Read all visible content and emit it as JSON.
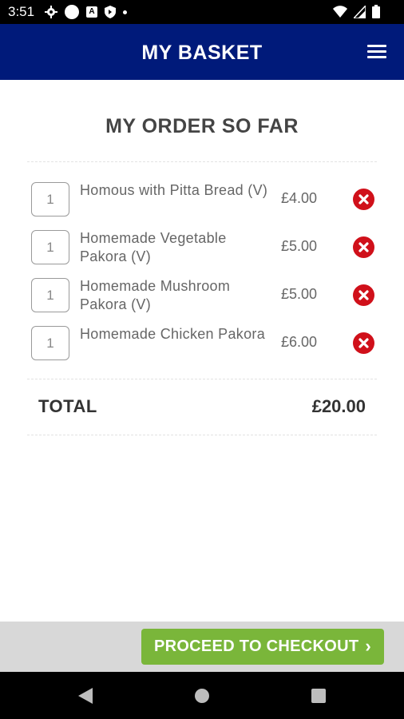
{
  "status_bar": {
    "time": "3:51",
    "left_icons": [
      "settings-gear-icon",
      "circle-notification-icon",
      "a-app-icon",
      "shield-icon",
      "dot-icon"
    ],
    "right_icons": [
      "wifi-icon",
      "signal-icon",
      "battery-icon"
    ]
  },
  "header": {
    "title": "MY BASKET",
    "menu_icon": "hamburger-menu-icon",
    "background_color": "#001a7a"
  },
  "order": {
    "title": "MY ORDER SO FAR",
    "items": [
      {
        "quantity": "1",
        "name": "Homous with Pitta Bread (V)",
        "price": "£4.00"
      },
      {
        "quantity": "1",
        "name": "Homemade Vegetable Pakora (V)",
        "price": "£5.00"
      },
      {
        "quantity": "1",
        "name": "Homemade Mushroom Pakora (V)",
        "price": "£5.00"
      },
      {
        "quantity": "1",
        "name": "Homemade Chicken Pakora",
        "price": "£6.00"
      }
    ],
    "remove_icon": "remove-x-circle-icon",
    "remove_color": "#d0101a"
  },
  "total": {
    "label": "TOTAL",
    "value": "£20.00"
  },
  "footer": {
    "checkout_label": "PROCEED TO CHECKOUT",
    "checkout_chevron": "›",
    "checkout_color": "#7ab63a"
  },
  "nav_bar": {
    "icons": [
      "back-triangle-icon",
      "home-circle-icon",
      "recents-square-icon"
    ]
  }
}
